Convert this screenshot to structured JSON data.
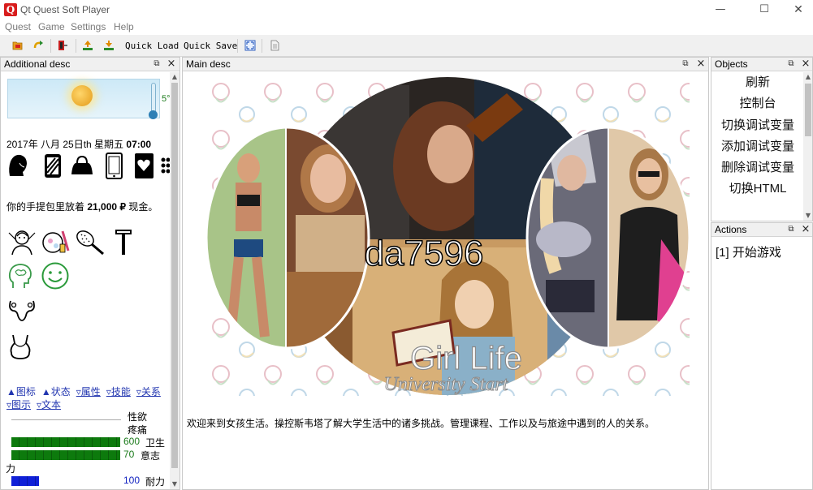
{
  "window": {
    "title": "Qt Quest Soft Player",
    "icon_letter": "Q",
    "minimize_glyph": "—",
    "maximize_glyph": "☐",
    "close_glyph": "✕"
  },
  "menu": [
    "Quest",
    "Game",
    "Settings",
    "Help"
  ],
  "toolbar": {
    "quick_load": "Quick Load",
    "quick_save": "Quick Save"
  },
  "left_panel": {
    "title": "Additional desc",
    "temperature": "5°",
    "date": "2017年 八月 25日th 星期五",
    "time": "07:00",
    "money_prefix": "你的手提包里放着",
    "money_amount": "21,000 ₽",
    "money_suffix": "现金。",
    "links_row1": [
      "▲图标",
      "▲状态",
      "▿属性",
      "▿技能",
      "▿关系"
    ],
    "links_row2": [
      "▿图示",
      "▿文本"
    ],
    "stats": {
      "libido_label": "性欲",
      "pain_label": "疼痛",
      "hygiene_value": "600",
      "hygiene_label": "卫生",
      "will_value": "70",
      "will_label": "意志",
      "will_wrap": "力",
      "stamina_value": "100",
      "stamina_label": "耐力"
    },
    "icons": [
      "head-silhouette-icon",
      "phone-case-icon",
      "handbag-icon",
      "smartphone-icon",
      "card-heart-icon",
      "more-icon",
      "salon-icon",
      "makeup-icon",
      "hairbrush-icon",
      "razor-icon",
      "brain-icon",
      "smiley-icon",
      "uterus-icon",
      "bra-icon"
    ]
  },
  "main_panel": {
    "title": "Main desc",
    "watermark": "da7596",
    "logo_title": "Girl Life",
    "logo_subtitle": "University Start",
    "intro": "欢迎来到女孩生活。操控斯韦塔了解大学生活中的诸多挑战。管理课程、工作以及与旅途中遇到的人的关系。"
  },
  "objects_panel": {
    "title": "Objects",
    "items": [
      "刷新",
      "控制台",
      "切换调试变量",
      "添加调试变量",
      "删除调试变量",
      "切换HTML"
    ]
  },
  "actions_panel": {
    "title": "Actions",
    "items": [
      "[1] 开始游戏"
    ]
  },
  "dock_buttons": {
    "float": "⧉",
    "close": "×"
  },
  "colors": {
    "stat_bar_green": "#0d7a0d",
    "stat_bar_blue": "#1020d8",
    "link_blue": "#2236b0",
    "stat_text_green": "#1a7a1a"
  },
  "stat_levels": {
    "hygiene_fill": 1.0,
    "will_fill": 1.0,
    "stamina_fill": 0.25
  }
}
